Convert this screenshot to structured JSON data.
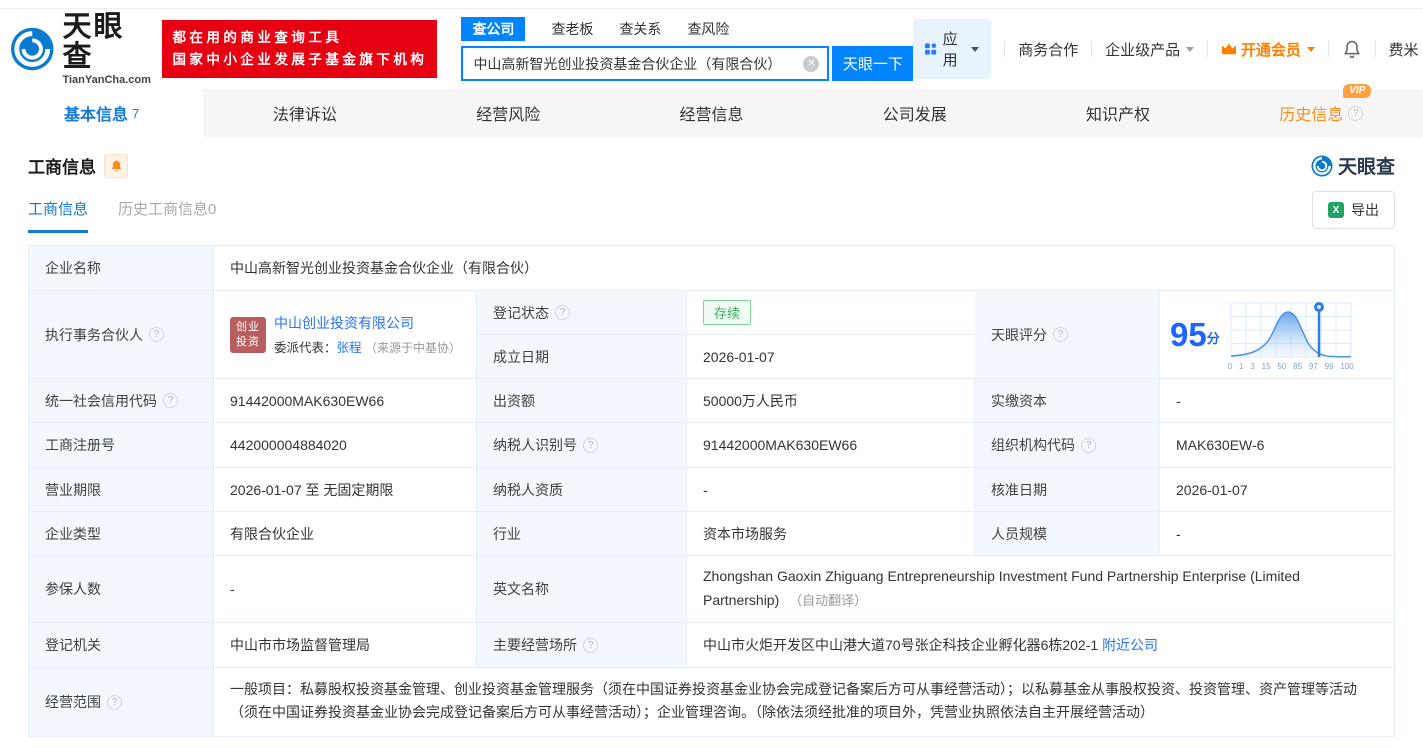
{
  "colors": {
    "brand_blue": "#0084ff",
    "banner_red": "#e60012",
    "link_blue": "#2972fa",
    "status_green": "#39ae5e",
    "vip_orange": "#ff8000",
    "score_blue": "#1a66ff"
  },
  "header": {
    "logo_cn": "天眼查",
    "logo_en": "TianYanCha.com",
    "banner_line1": "都在用的商业查询工具",
    "banner_line2": "国家中小企业发展子基金旗下机构",
    "search_tabs": [
      {
        "label": "查公司"
      },
      {
        "label": "查老板"
      },
      {
        "label": "查关系"
      },
      {
        "label": "查风险"
      }
    ],
    "search_value": "中山高新智光创业投资基金合伙企业（有限合伙）",
    "search_button": "天眼一下",
    "menu_app": "应用",
    "menu_cooperation": "商务合作",
    "menu_enterprise": "企业级产品",
    "menu_vip": "开通会员",
    "menu_user": "费米"
  },
  "nav": {
    "tabs": [
      {
        "label": "基本信息",
        "count": "7"
      },
      {
        "label": "法律诉讼"
      },
      {
        "label": "经营风险"
      },
      {
        "label": "经营信息"
      },
      {
        "label": "公司发展"
      },
      {
        "label": "知识产权"
      },
      {
        "label": "历史信息",
        "vip": "VIP"
      }
    ]
  },
  "section": {
    "title": "工商信息",
    "watermark": "天眼查",
    "sub_tabs": [
      {
        "label": "工商信息"
      },
      {
        "label": "历史工商信息0"
      }
    ],
    "export_label": "导出"
  },
  "table": {
    "company_name": {
      "label": "企业名称",
      "value": "中山高新智光创业投资基金合伙企业（有限合伙）"
    },
    "executive_partner": {
      "label": "执行事务合伙人",
      "badge": "创业投资",
      "company": "中山创业投资有限公司",
      "rep_label": "委派代表：",
      "rep_name": "张程",
      "rep_source": "（来源于中基协）"
    },
    "reg_status": {
      "label": "登记状态",
      "value": "存续"
    },
    "establish_date": {
      "label": "成立日期",
      "value": "2026-01-07"
    },
    "score": {
      "label": "天眼评分",
      "value": "95",
      "unit": "分",
      "axis": [
        "0",
        "1",
        "3",
        "15",
        "50",
        "85",
        "97",
        "99",
        "100"
      ]
    },
    "credit_code": {
      "label": "统一社会信用代码",
      "value": "91442000MAK630EW66"
    },
    "capital": {
      "label": "出资额",
      "value": "50000万人民币"
    },
    "paid_capital": {
      "label": "实缴资本",
      "value": "-"
    },
    "reg_number": {
      "label": "工商注册号",
      "value": "442000004884020"
    },
    "taxpayer_id": {
      "label": "纳税人识别号",
      "value": "91442000MAK630EW66"
    },
    "org_code": {
      "label": "组织机构代码",
      "value": "MAK630EW-6"
    },
    "business_term": {
      "label": "营业期限",
      "value": "2026-01-07 至 无固定期限"
    },
    "taxpayer_quality": {
      "label": "纳税人资质",
      "value": "-"
    },
    "approval_date": {
      "label": "核准日期",
      "value": "2026-01-07"
    },
    "company_type": {
      "label": "企业类型",
      "value": "有限合伙企业"
    },
    "industry": {
      "label": "行业",
      "value": "资本市场服务"
    },
    "staff_size": {
      "label": "人员规模",
      "value": "-"
    },
    "insured_count": {
      "label": "参保人数",
      "value": "-"
    },
    "english_name": {
      "label": "英文名称",
      "value": "Zhongshan Gaoxin Zhiguang Entrepreneurship Investment Fund Partnership Enterprise (Limited Partnership)",
      "note": "（自动翻译）"
    },
    "reg_authority": {
      "label": "登记机关",
      "value": "中山市市场监督管理局"
    },
    "business_address": {
      "label": "主要经营场所",
      "value": "中山市火炬开发区中山港大道70号张企科技企业孵化器6栋202-1",
      "link": "附近公司"
    },
    "business_scope": {
      "label": "经营范围",
      "value": "一般项目：私募股权投资基金管理、创业投资基金管理服务（须在中国证券投资基金业协会完成登记备案后方可从事经营活动）；以私募基金从事股权投资、投资管理、资产管理等活动（须在中国证券投资基金业协会完成登记备案后方可从事经营活动）；企业管理咨询。（除依法须经批准的项目外，凭营业执照依法自主开展经营活动）"
    }
  }
}
